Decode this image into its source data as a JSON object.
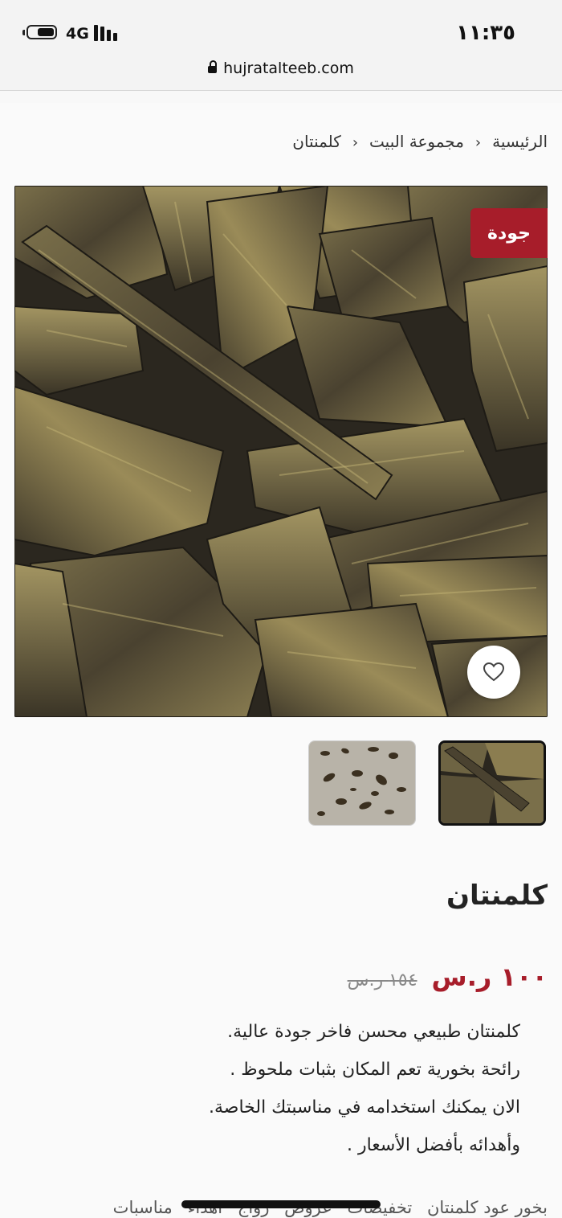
{
  "status_bar": {
    "network": "4G",
    "time": "١١:٣٥",
    "url": "hujratalteeb.com"
  },
  "breadcrumb": {
    "home": "الرئيسية",
    "category": "مجموعة البيت",
    "current": "كلمنتان",
    "separator": "‹"
  },
  "product": {
    "badge": "جودة",
    "title": "كلمنتان",
    "price": "١٠٠ ر.س",
    "old_price": "١٥٤ ر.س",
    "description": [
      "كلمنتان طبيعي محسن فاخر جودة عالية.",
      "رائحة بخورية تعم المكان بثبات ملحوظ .",
      "الان يمكنك استخدامه في مناسبتك الخاصة.",
      "وأهدائه بأفضل الأسعار ."
    ],
    "tags": [
      "بخور عود كلمنتان",
      "تخفيضات",
      "عروض",
      "زواج",
      "اهداء",
      "مناسبات"
    ]
  },
  "colors": {
    "accent": "#a71d2a",
    "text": "#222222"
  },
  "icons": {
    "lock": "lock-icon",
    "heart": "heart-icon",
    "chevron": "chevron-left-icon"
  }
}
